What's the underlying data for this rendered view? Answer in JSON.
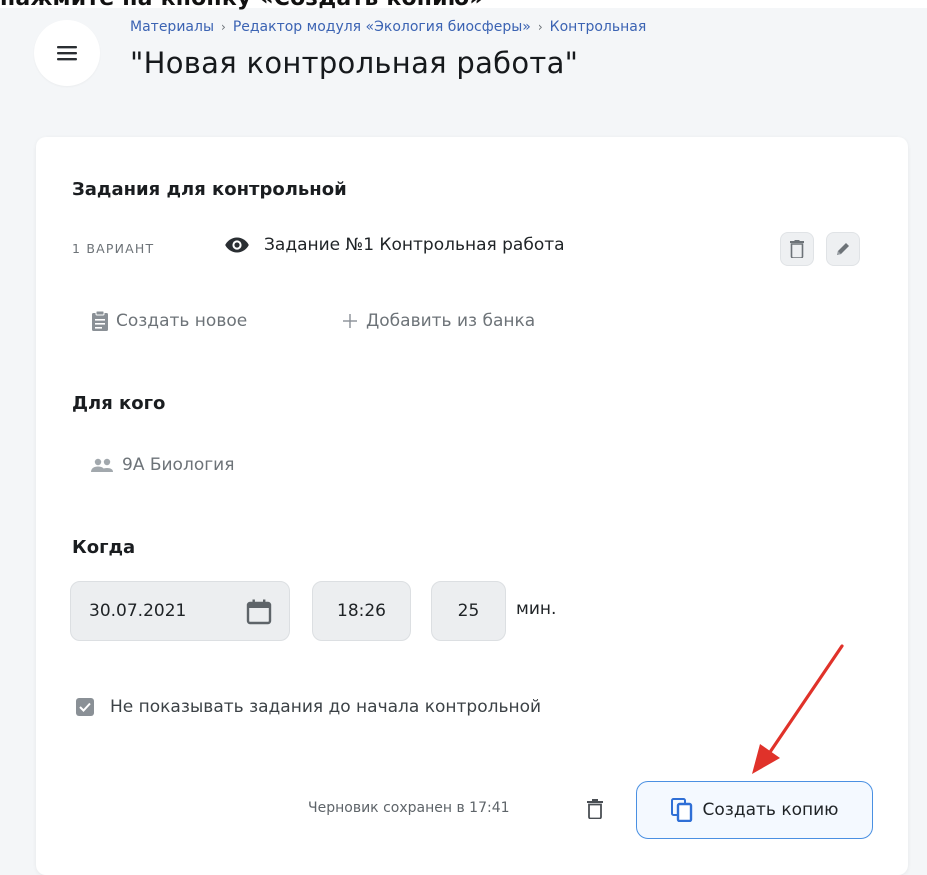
{
  "caption": "нажмите на кнопку «Создать копию»",
  "breadcrumb": {
    "items": [
      "Материалы",
      "Редактор модуля «Экология биосферы»",
      "Контрольная"
    ],
    "separator": "›"
  },
  "page_title": "\"Новая контрольная работа\"",
  "tasks_section": {
    "title": "Задания для контрольной",
    "variant_label": "1 ВАРИАНТ",
    "task_name": "Задание №1 Контрольная работа",
    "create_new_label": "Создать новое",
    "add_from_bank_label": "Добавить из банка"
  },
  "for_whom_section": {
    "title": "Для кого",
    "group": "9А Биология"
  },
  "when_section": {
    "title": "Когда",
    "date": "30.07.2021",
    "time": "18:26",
    "duration": "25",
    "duration_unit": "мин."
  },
  "hide_tasks_checkbox": {
    "label": "Не показывать задания до начала контрольной",
    "checked": true
  },
  "footer": {
    "draft_status": "Черновик сохранен в 17:41",
    "copy_button_label": "Создать копию"
  },
  "colors": {
    "accent": "#4a90e2",
    "link": "#3b63b3",
    "arrow": "#e0322a"
  }
}
